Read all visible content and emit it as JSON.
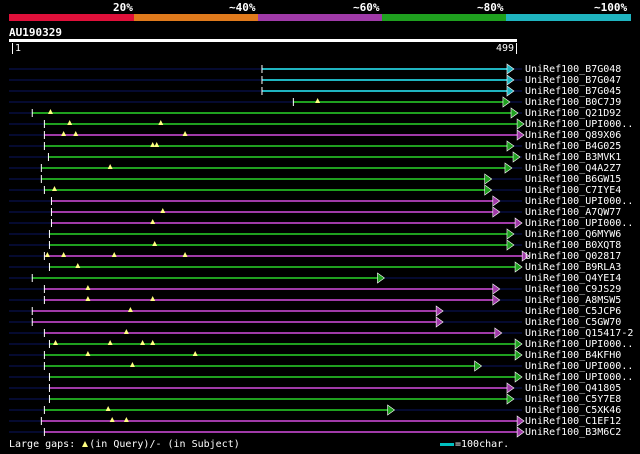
{
  "legend": {
    "labels": [
      "20%",
      "~40%",
      "~60%",
      "~80%",
      "~100%"
    ],
    "colors": [
      "#e0103a",
      "#e07a1c",
      "#a03aa8",
      "#1fa01f",
      "#1fb4c0"
    ]
  },
  "query": {
    "id": "AU190329",
    "start": "1",
    "end": "499"
  },
  "hits": [
    {
      "name": "UniRef100_B7G048",
      "cls": 4,
      "start": 248,
      "end": 497,
      "gaps": []
    },
    {
      "name": "UniRef100_B7G047",
      "cls": 4,
      "start": 248,
      "end": 497,
      "gaps": []
    },
    {
      "name": "UniRef100_B7G045",
      "cls": 4,
      "start": 248,
      "end": 497,
      "gaps": []
    },
    {
      "name": "UniRef100_B0C7J9",
      "cls": 3,
      "start": 279,
      "end": 493,
      "gaps": [
        303
      ]
    },
    {
      "name": "UniRef100_Q21D92",
      "cls": 3,
      "start": 21,
      "end": 501,
      "gaps": [
        39
      ]
    },
    {
      "name": "UniRef100_UPI000..",
      "cls": 3,
      "start": 33,
      "end": 507,
      "gaps": [
        58,
        148
      ]
    },
    {
      "name": "UniRef100_Q89X06",
      "cls": 2,
      "start": 33,
      "end": 507,
      "gaps": [
        52,
        64,
        172
      ]
    },
    {
      "name": "UniRef100_B4G025",
      "cls": 3,
      "start": 33,
      "end": 497,
      "gaps": [
        140,
        144
      ]
    },
    {
      "name": "UniRef100_B3MVK1",
      "cls": 3,
      "start": 37,
      "end": 503,
      "gaps": []
    },
    {
      "name": "UniRef100_Q4A2Z7",
      "cls": 3,
      "start": 30,
      "end": 495,
      "gaps": [
        98
      ]
    },
    {
      "name": "UniRef100_B6GW15",
      "cls": 3,
      "start": 30,
      "end": 475,
      "gaps": []
    },
    {
      "name": "UniRef100_C7IYE4",
      "cls": 3,
      "start": 33,
      "end": 475,
      "gaps": [
        43
      ]
    },
    {
      "name": "UniRef100_UPI000..",
      "cls": 2,
      "start": 40,
      "end": 483,
      "gaps": []
    },
    {
      "name": "UniRef100_A7QW77",
      "cls": 2,
      "start": 40,
      "end": 483,
      "gaps": [
        150
      ]
    },
    {
      "name": "UniRef100_UPI000..",
      "cls": 2,
      "start": 40,
      "end": 505,
      "gaps": [
        140
      ]
    },
    {
      "name": "UniRef100_Q6MYW6",
      "cls": 3,
      "start": 38,
      "end": 497,
      "gaps": []
    },
    {
      "name": "UniRef100_B0XQT8",
      "cls": 3,
      "start": 38,
      "end": 497,
      "gaps": [
        142
      ]
    },
    {
      "name": "UniRef100_Q02817",
      "cls": 2,
      "start": 33,
      "end": 512,
      "gaps": [
        36,
        52,
        102,
        172
      ]
    },
    {
      "name": "UniRef100_B9RLA3",
      "cls": 3,
      "start": 38,
      "end": 505,
      "gaps": [
        66
      ]
    },
    {
      "name": "UniRef100_Q4YEI4",
      "cls": 3,
      "start": 21,
      "end": 369,
      "gaps": []
    },
    {
      "name": "UniRef100_C9JS29",
      "cls": 2,
      "start": 33,
      "end": 483,
      "gaps": [
        76
      ]
    },
    {
      "name": "UniRef100_A8MSW5",
      "cls": 2,
      "start": 33,
      "end": 483,
      "gaps": [
        76,
        140
      ]
    },
    {
      "name": "UniRef100_C5JCP6",
      "cls": 2,
      "start": 21,
      "end": 427,
      "gaps": [
        118
      ]
    },
    {
      "name": "UniRef100_C5GW70",
      "cls": 2,
      "start": 21,
      "end": 427,
      "gaps": []
    },
    {
      "name": "UniRef100_Q15417-2",
      "cls": 2,
      "start": 33,
      "end": 485,
      "gaps": [
        114
      ]
    },
    {
      "name": "UniRef100_UPI000..",
      "cls": 3,
      "start": 38,
      "end": 505,
      "gaps": [
        44,
        98,
        130,
        140
      ]
    },
    {
      "name": "UniRef100_B4KFH0",
      "cls": 3,
      "start": 33,
      "end": 505,
      "gaps": [
        76,
        182
      ]
    },
    {
      "name": "UniRef100_UPI000..",
      "cls": 3,
      "start": 33,
      "end": 465,
      "gaps": [
        120
      ]
    },
    {
      "name": "UniRef100_UPI000..",
      "cls": 3,
      "start": 38,
      "end": 505,
      "gaps": []
    },
    {
      "name": "UniRef100_Q41805",
      "cls": 2,
      "start": 38,
      "end": 497,
      "gaps": []
    },
    {
      "name": "UniRef100_C5Y7E8",
      "cls": 3,
      "start": 38,
      "end": 497,
      "gaps": []
    },
    {
      "name": "UniRef100_C5XK46",
      "cls": 3,
      "start": 33,
      "end": 379,
      "gaps": [
        96
      ]
    },
    {
      "name": "UniRef100_C1EF12",
      "cls": 2,
      "start": 30,
      "end": 507,
      "gaps": [
        100,
        114
      ]
    },
    {
      "name": "UniRef100_B3M6C2",
      "cls": 2,
      "start": 33,
      "end": 507,
      "gaps": []
    }
  ],
  "footer": {
    "text_before": "Large gaps: ",
    "text_after": "(in Query)/- (in Subject)",
    "scale_label": "=100char."
  }
}
